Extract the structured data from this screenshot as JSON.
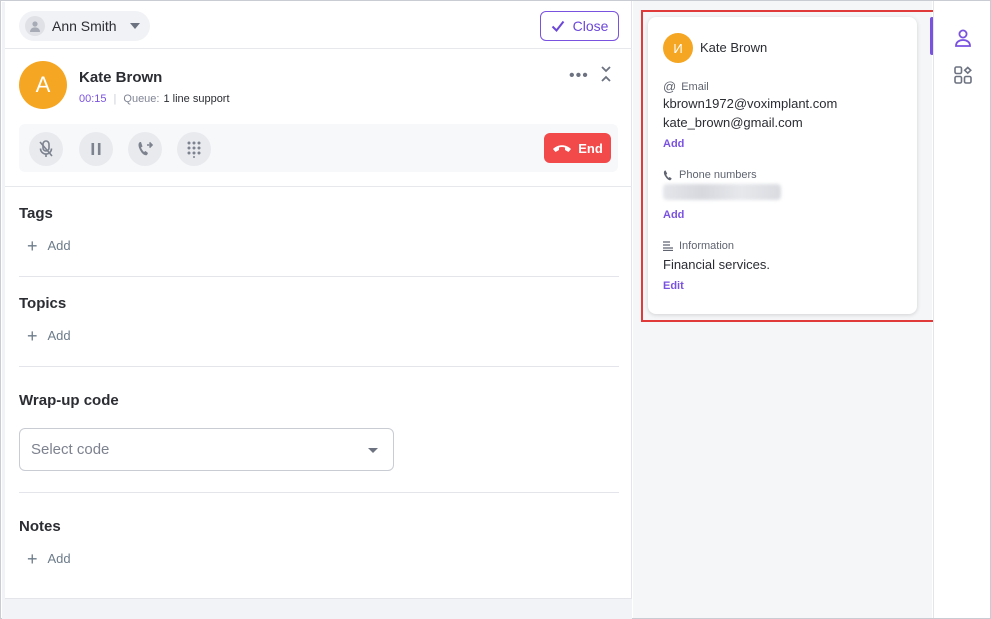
{
  "header": {
    "agent_name": "Ann Smith",
    "close_label": "Close"
  },
  "call": {
    "avatar_letter": "A",
    "caller_name": "Kate Brown",
    "timer": "00:15",
    "queue_label": "Queue:",
    "queue_value": "1 line support",
    "end_label": "End",
    "controls": [
      "mic-off-icon",
      "pause-icon",
      "transfer-icon",
      "dialpad-icon"
    ]
  },
  "sections": {
    "tags_title": "Tags",
    "topics_title": "Topics",
    "wrapup_title": "Wrap-up code",
    "wrapup_placeholder": "Select code",
    "notes_title": "Notes",
    "add_label": "Add"
  },
  "contact": {
    "avatar_letter": "И",
    "name": "Kate Brown",
    "email_label": "Email",
    "emails": [
      "kbrown1972@voximplant.com",
      "kate_brown@gmail.com"
    ],
    "email_add": "Add",
    "phone_label": "Phone numbers",
    "phone_add": "Add",
    "info_label": "Information",
    "info_value": "Financial services.",
    "info_edit": "Edit"
  },
  "colors": {
    "accent": "#7a52e0",
    "avatar": "#f5a623",
    "end": "#f2494a",
    "highlight": "#e03a3a"
  }
}
